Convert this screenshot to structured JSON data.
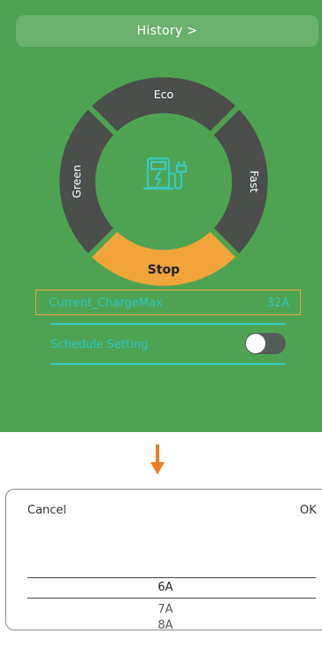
{
  "header": {
    "history_label": "History  >"
  },
  "mode_dial": {
    "segments": {
      "eco": "Eco",
      "fast": "Fast",
      "green": "Green"
    },
    "stop_label": "Stop",
    "center_icon": "ev-charger-icon"
  },
  "settings": {
    "current_charge_max": {
      "label": "Current_ChargeMax",
      "value": "32A"
    },
    "schedule": {
      "label": "Schedule Setting",
      "enabled": false
    }
  },
  "arrow_icon": "arrow-down-icon",
  "picker": {
    "cancel_label": "Cancel",
    "ok_label": "OK",
    "options": [
      "6A",
      "7A",
      "8A"
    ],
    "selected": "6A"
  },
  "colors": {
    "panel_bg": "#4ea352",
    "segment": "#4a4f4b",
    "stop": "#f0a43a",
    "accent": "#38c9c4",
    "arrow": "#ef7d22"
  }
}
